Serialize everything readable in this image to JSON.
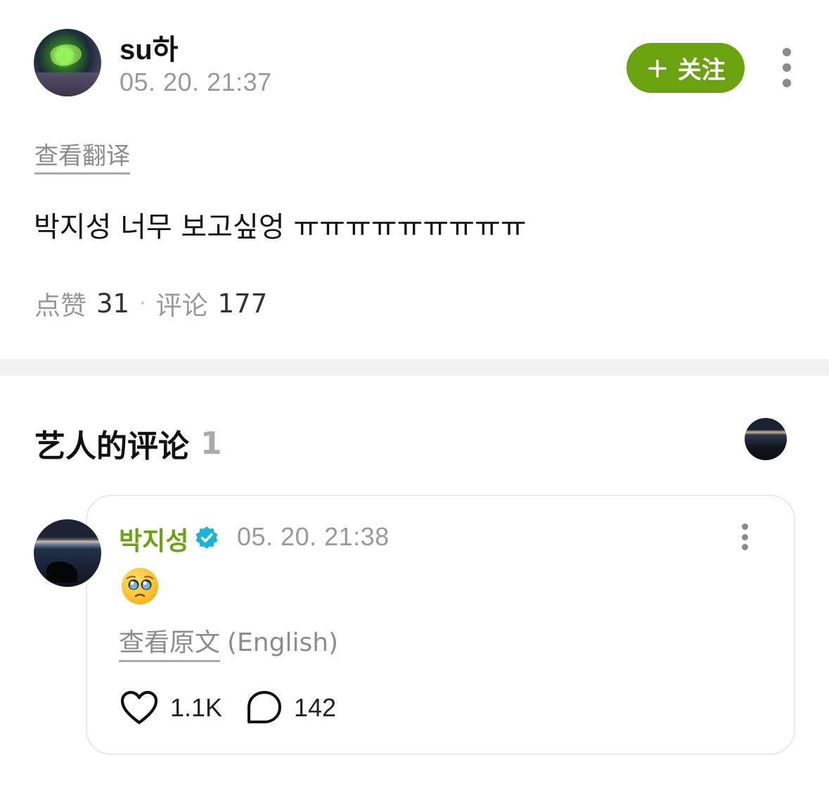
{
  "post": {
    "author": "su하",
    "time": "05. 20. 21:37",
    "follow_label": "关注",
    "follow_icon": "plus-icon",
    "translate_link": "查看翻译",
    "body": "박지성 너무 보고싶엉 ㅠㅠㅠㅠㅠㅠㅠㅠㅠ",
    "likes_label": "点赞",
    "likes_count": "31",
    "separator": "·",
    "comments_label": "评论",
    "comments_count": "177"
  },
  "artist_section": {
    "title": "艺人的评论",
    "count": "1"
  },
  "artist_comment": {
    "author": "박지성",
    "verified_icon": "verified-badge-icon",
    "time": "05. 20. 21:38",
    "emoji": "pleading-face-emoji",
    "original_link": "查看原文",
    "original_lang": "(English)",
    "like_count": "1.1K",
    "reply_count": "142"
  },
  "colors": {
    "accent_green": "#6aa30f",
    "verified_blue": "#18b5d6",
    "muted_text": "#999999"
  }
}
